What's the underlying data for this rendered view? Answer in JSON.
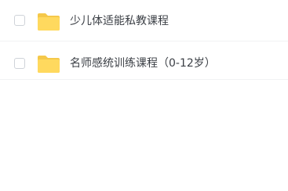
{
  "files": [
    {
      "name": "少儿体适能私教课程",
      "icon": "folder-icon",
      "selected": false
    },
    {
      "name": "名师感统训练课程（0-12岁）",
      "icon": "folder-icon",
      "selected": false
    }
  ],
  "colors": {
    "folder_back": "#f5c84a",
    "folder_front": "#ffd95e",
    "text": "#3b3f45",
    "divider": "#f1f2f4",
    "checkbox_border": "#cfd3d9"
  }
}
